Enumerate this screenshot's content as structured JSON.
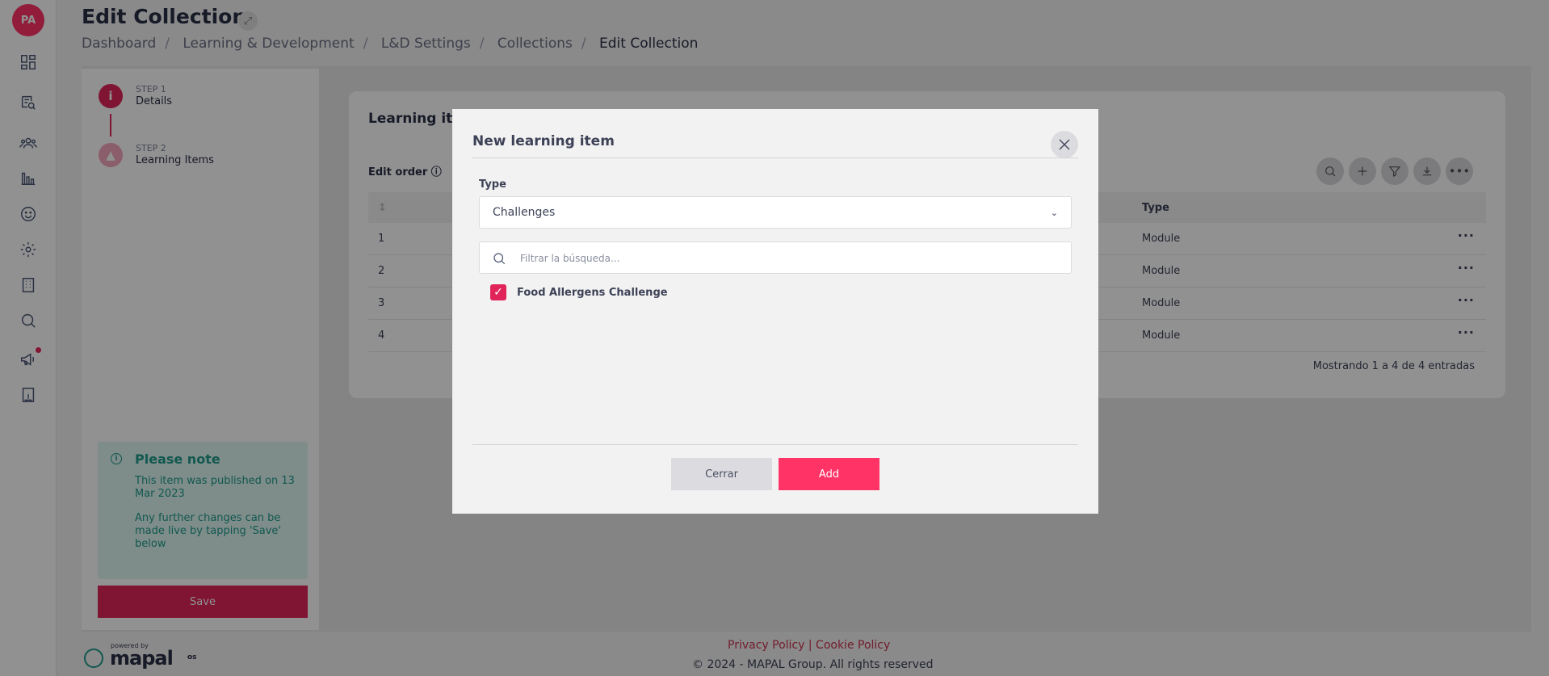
{
  "user": {
    "initials": "PA"
  },
  "sidebar": {
    "icons": [
      "dashboard-icon",
      "search-document-icon",
      "users-icon",
      "bar-chart-icon",
      "smiley-icon",
      "gear-icon",
      "building-icon",
      "search-icon",
      "megaphone-icon",
      "info-book-icon"
    ],
    "notification_color": "#e8245a"
  },
  "page": {
    "title": "Edit Collection",
    "breadcrumb": [
      "Dashboard",
      "Learning & Development",
      "L&D Settings",
      "Collections",
      "Edit Collection"
    ]
  },
  "steps": [
    {
      "number": "STEP 1",
      "name": "Details",
      "icon": "info-icon"
    },
    {
      "number": "STEP 2",
      "name": "Learning Items",
      "icon": "graduation-cap-icon"
    }
  ],
  "note": {
    "title": "Please note",
    "line1": "This item was published on 13 Mar 2023",
    "line2": "Any further changes can be made live by tapping 'Save' below"
  },
  "save_label": "Save",
  "card": {
    "title": "Learning items",
    "edit_order": "Edit order",
    "tools": [
      "search-icon",
      "plus-icon",
      "filter-icon",
      "download-icon",
      "more-icon"
    ],
    "table": {
      "headers": {
        "num": "↕",
        "type": "Type"
      },
      "rows": [
        {
          "num": "1",
          "type": "Module"
        },
        {
          "num": "2",
          "type": "Module"
        },
        {
          "num": "3",
          "type": "Module"
        },
        {
          "num": "4",
          "type": "Module"
        }
      ],
      "info": "Mostrando 1 a 4 de 4 entradas"
    }
  },
  "footer": {
    "privacy": "Privacy Policy",
    "divider": " | ",
    "cookie": "Cookie Policy",
    "copyright": "© 2024 - MAPAL Group. All rights reserved",
    "powered_by": "powered by",
    "brand": "mapal",
    "brand_suffix": "os"
  },
  "modal": {
    "title": "New learning item",
    "type_label": "Type",
    "type_value": "Challenges",
    "search_placeholder": "Filtrar la búsqueda...",
    "items": [
      {
        "label": "Food Allergens Challenge",
        "checked": true
      }
    ],
    "close_label": "Cerrar",
    "add_label": "Add"
  },
  "colors": {
    "accent": "#e0245a",
    "primary_button": "#ff3366",
    "note_text": "#1e9c8c"
  }
}
